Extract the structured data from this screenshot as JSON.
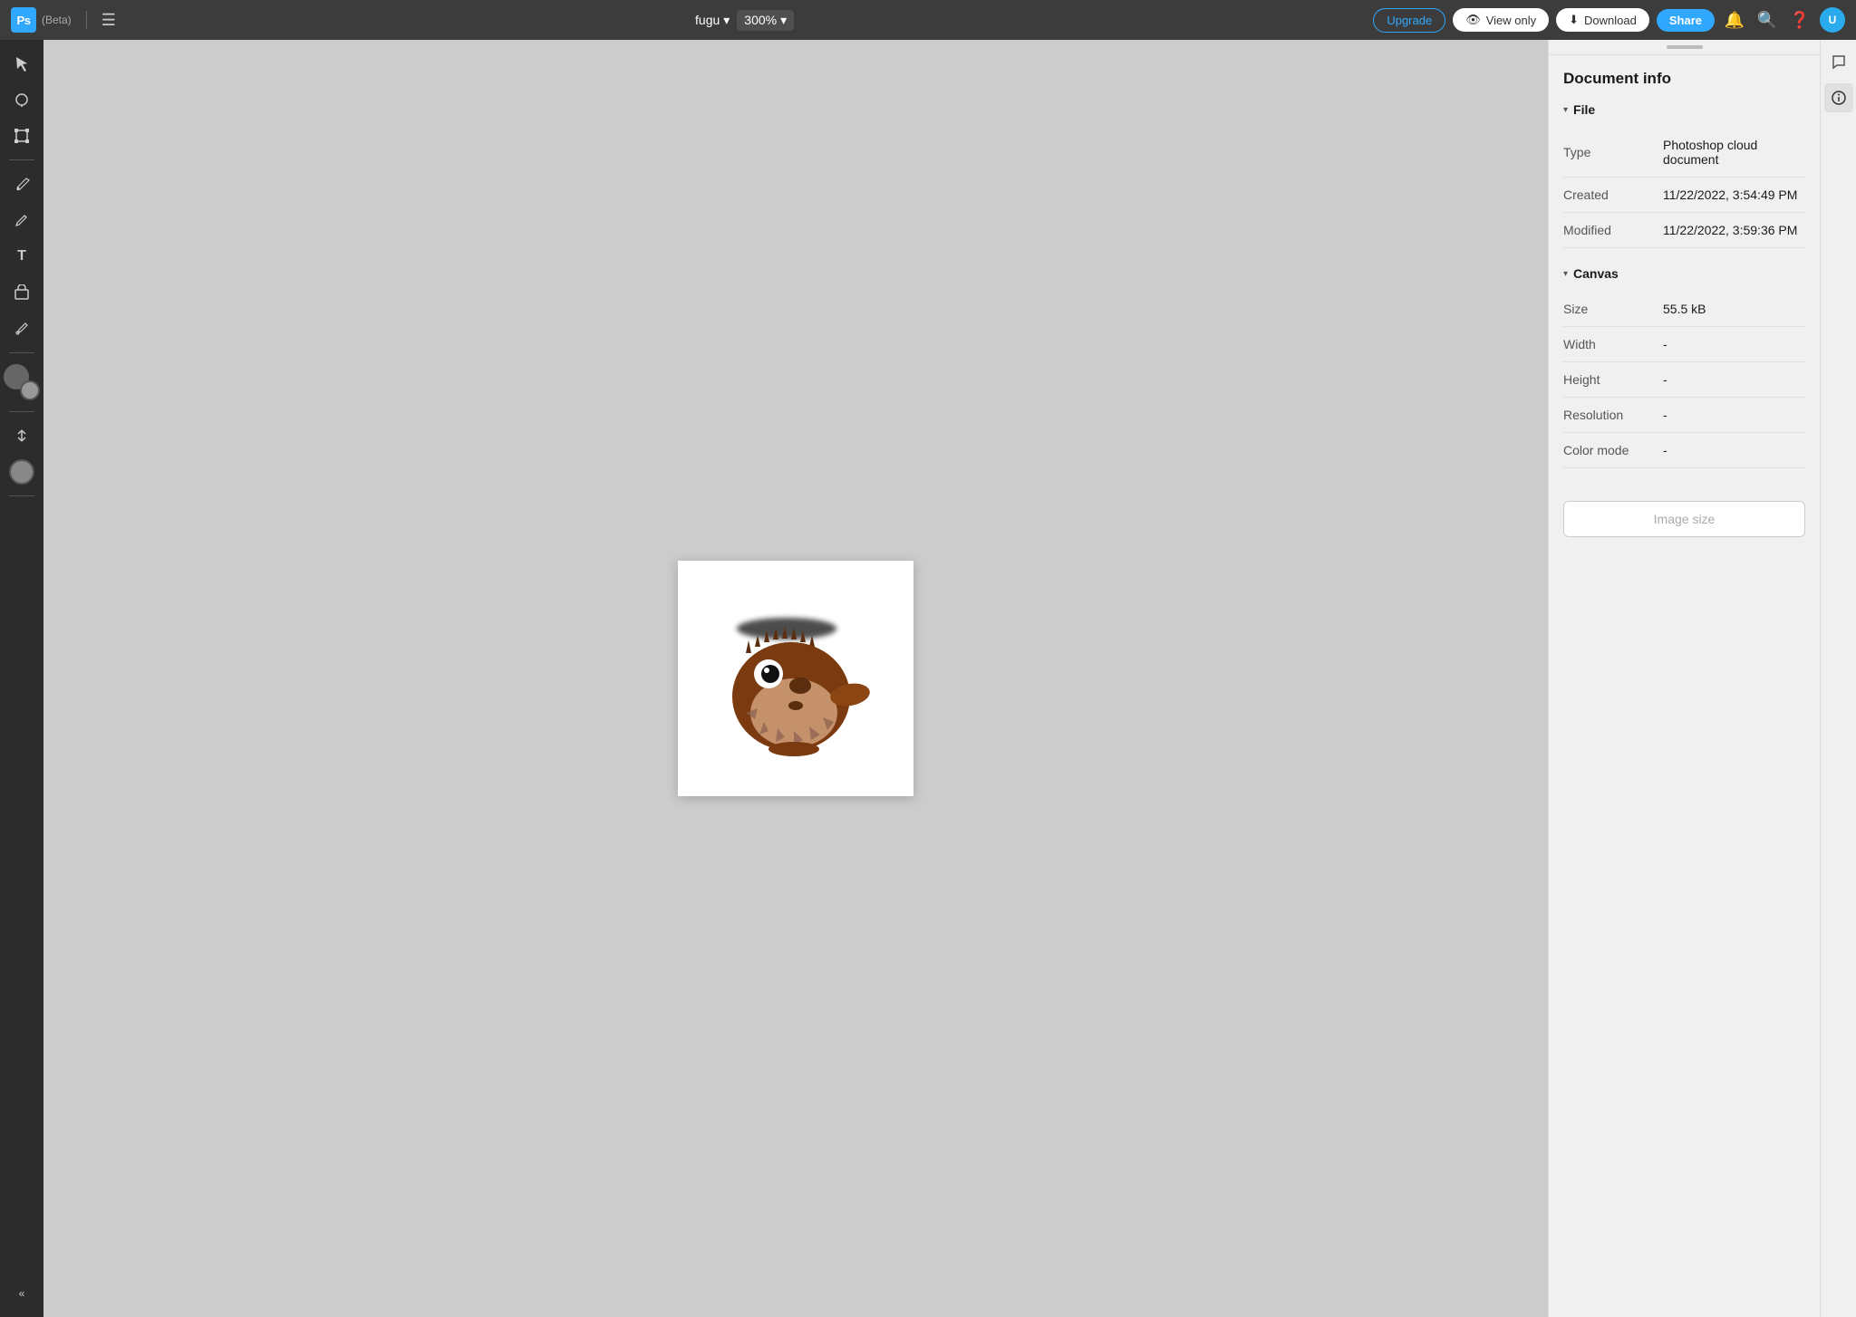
{
  "header": {
    "logo_text": "Ps",
    "beta_label": "(Beta)",
    "file_name": "fugu",
    "zoom_level": "300%",
    "upgrade_label": "Upgrade",
    "view_only_label": "View only",
    "download_label": "Download",
    "share_label": "Share"
  },
  "toolbar": {
    "tools": [
      {
        "name": "select",
        "icon": "↖",
        "label": "Select"
      },
      {
        "name": "lasso",
        "icon": "⊙",
        "label": "Lasso"
      },
      {
        "name": "transform",
        "icon": "⊞",
        "label": "Transform"
      },
      {
        "name": "brush",
        "icon": "✏",
        "label": "Brush"
      },
      {
        "name": "pen",
        "icon": "✒",
        "label": "Pen"
      },
      {
        "name": "text",
        "icon": "T",
        "label": "Text"
      },
      {
        "name": "shape",
        "icon": "✦",
        "label": "Shape"
      },
      {
        "name": "eyedropper",
        "icon": "⌖",
        "label": "Eyedropper"
      }
    ],
    "collapse_label": "«"
  },
  "document_info": {
    "title": "Document info",
    "file_section": {
      "label": "File",
      "rows": [
        {
          "label": "Type",
          "value": "Photoshop cloud document"
        },
        {
          "label": "Created",
          "value": "11/22/2022, 3:54:49 PM"
        },
        {
          "label": "Modified",
          "value": "11/22/2022, 3:59:36 PM"
        }
      ]
    },
    "canvas_section": {
      "label": "Canvas",
      "rows": [
        {
          "label": "Size",
          "value": "55.5 kB"
        },
        {
          "label": "Width",
          "value": "-"
        },
        {
          "label": "Height",
          "value": "-"
        },
        {
          "label": "Resolution",
          "value": "-"
        },
        {
          "label": "Color mode",
          "value": "-"
        }
      ]
    },
    "image_size_button": "Image size"
  },
  "colors": {
    "accent_blue": "#31a8ff",
    "bg_dark": "#3c3c3c",
    "toolbar_bg": "#2c2c2c",
    "panel_bg": "#f0f0f0",
    "canvas_bg": "#cccccc"
  }
}
